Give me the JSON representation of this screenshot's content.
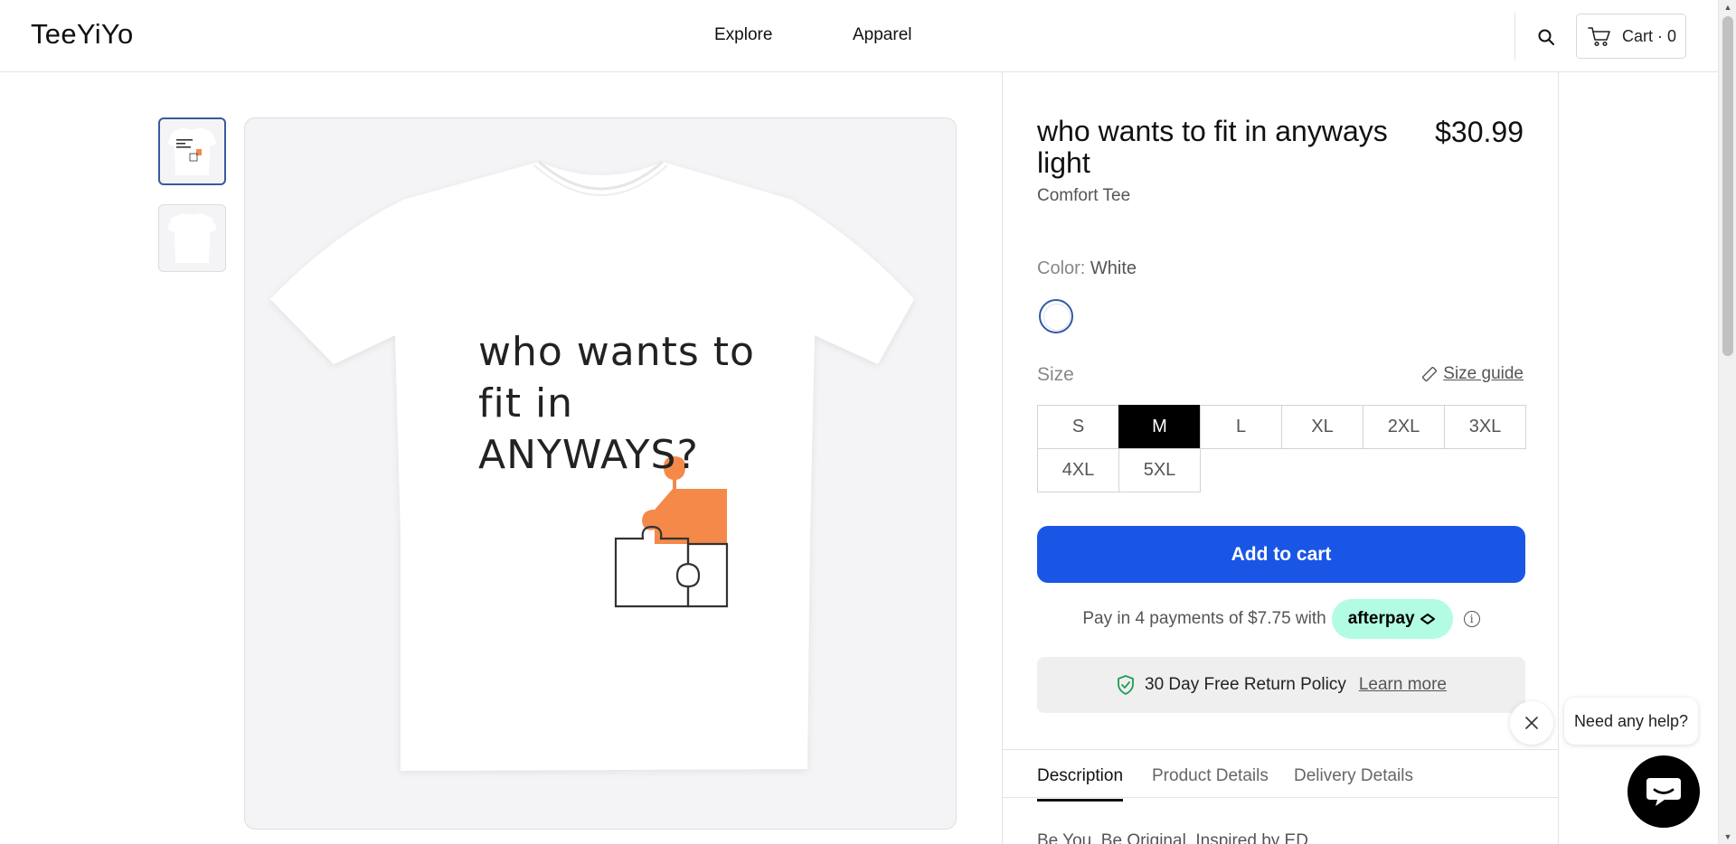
{
  "header": {
    "logo": "TeeYiYo",
    "nav": [
      "Explore",
      "Apparel"
    ],
    "cart_label": "Cart · 0"
  },
  "gallery": {
    "shirt_lines": [
      "who wants to",
      "fit in",
      "ANYWAYS?"
    ]
  },
  "product": {
    "title": "who wants to fit in anyways light",
    "price": "$30.99",
    "type": "Comfort Tee",
    "color_label": "Color:",
    "color_value": "White",
    "size_label": "Size",
    "size_guide": "Size guide",
    "sizes": [
      "S",
      "M",
      "L",
      "XL",
      "2XL",
      "3XL",
      "4XL",
      "5XL"
    ],
    "selected_size": "M",
    "add_to_cart": "Add to cart",
    "afterpay_text": "Pay in 4 payments of $7.75 with",
    "afterpay_brand": "afterpay",
    "afterpay_info": "i",
    "return_policy": "30 Day Free Return Policy",
    "learn_more": "Learn more",
    "tabs": [
      "Description",
      "Product Details",
      "Delivery Details"
    ],
    "description": "Be You. Be Original. Inspired by ED."
  },
  "chat": {
    "prompt": "Need any help?"
  },
  "colors": {
    "accent": "#1a56e5",
    "afterpay": "#b2fce4",
    "puzzle_orange": "#f4894a",
    "swatch_border": "#2f5aa8"
  }
}
